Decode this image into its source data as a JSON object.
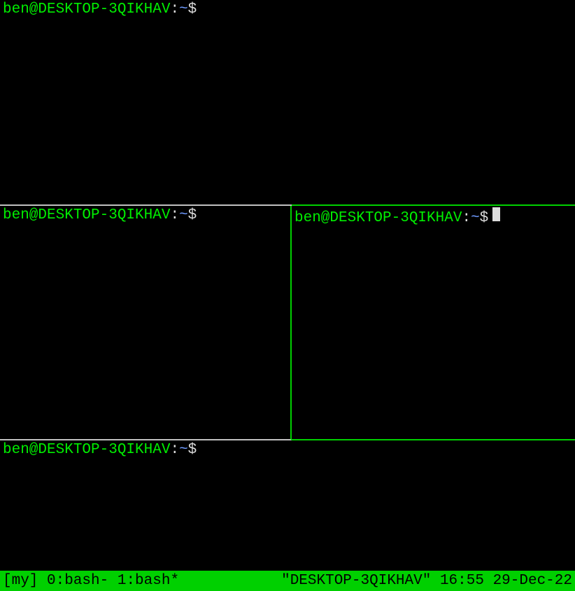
{
  "prompt": {
    "user_host": "ben@DESKTOP-3QIKHAV",
    "colon": ":",
    "path": "~",
    "dollar": "$"
  },
  "panes": {
    "top": {
      "has_cursor": false
    },
    "mid_left": {
      "has_cursor": false
    },
    "mid_right": {
      "has_cursor": true
    },
    "bottom": {
      "has_cursor": false
    }
  },
  "status": {
    "session": "[my]",
    "windows": " 0:bash- 1:bash*",
    "hostname": "\"DESKTOP-3QIKHAV\"",
    "time": " 16:55",
    "date": " 29-Dec-22"
  }
}
